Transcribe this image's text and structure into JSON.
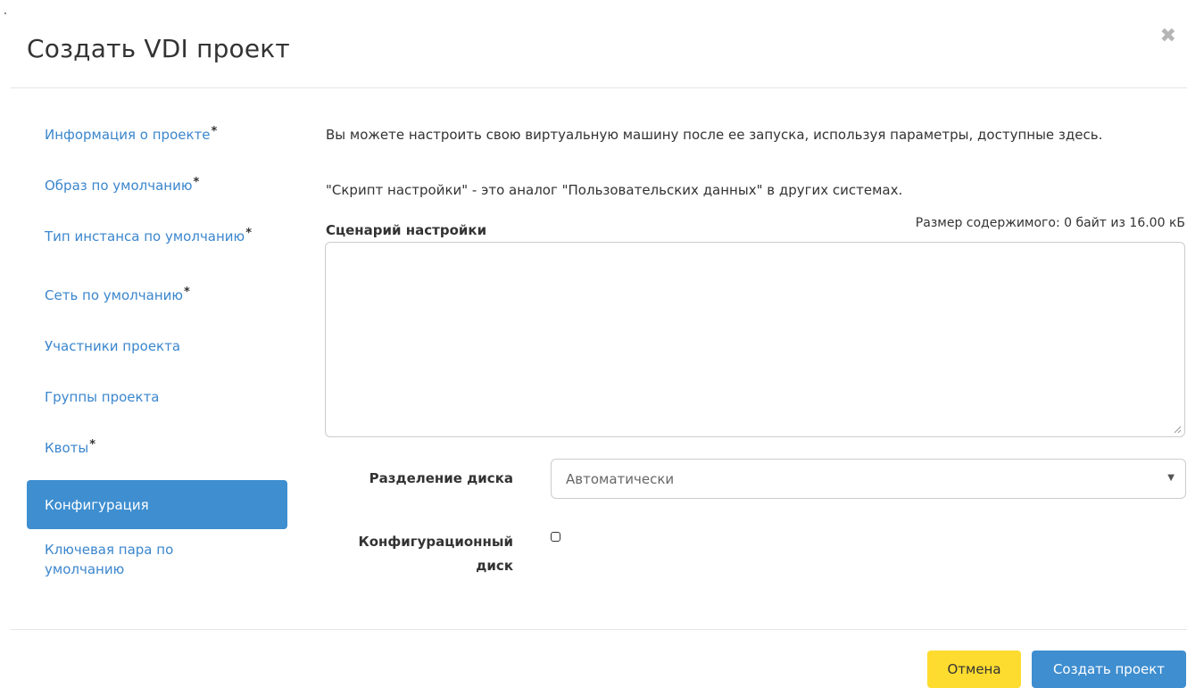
{
  "modal": {
    "title": "Создать VDI проект",
    "close_symbol": "✖"
  },
  "nav": {
    "required_marker": "*",
    "items": [
      {
        "label": "Информация о проекте",
        "required": true
      },
      {
        "label": "Образ по умолчанию",
        "required": true
      },
      {
        "label": "Тип инстанса по умолчанию",
        "required": true
      },
      {
        "label": "Сеть по умолчанию",
        "required": true
      },
      {
        "label": "Участники проекта",
        "required": false
      },
      {
        "label": "Группы проекта",
        "required": false
      },
      {
        "label": "Квоты",
        "required": true
      },
      {
        "label": "Конфигурация",
        "required": false,
        "active": true
      },
      {
        "label": "Ключевая пара по умолчанию",
        "required": false
      }
    ]
  },
  "content": {
    "help_text_1": "Вы можете настроить свою виртуальную машину после ее запуска, используя параметры, доступные здесь.",
    "help_text_2": "\"Скрипт настройки\" - это аналог \"Пользовательских данных\" в других системах.",
    "script_label": "Сценарий настройки",
    "content_size": "Размер содержимого: 0 байт из 16.00 кБ",
    "script_value": "",
    "disk_partition_label": "Разделение диска",
    "disk_partition_value": "Автоматически",
    "config_drive_label": "Конфигурационный диск",
    "config_drive_checked": false
  },
  "footer": {
    "cancel_label": "Отмена",
    "create_label": "Создать проект"
  },
  "colors": {
    "accent": "#3e8ed0",
    "link": "#3b86cd",
    "cancel_button": "#fddc2f"
  }
}
